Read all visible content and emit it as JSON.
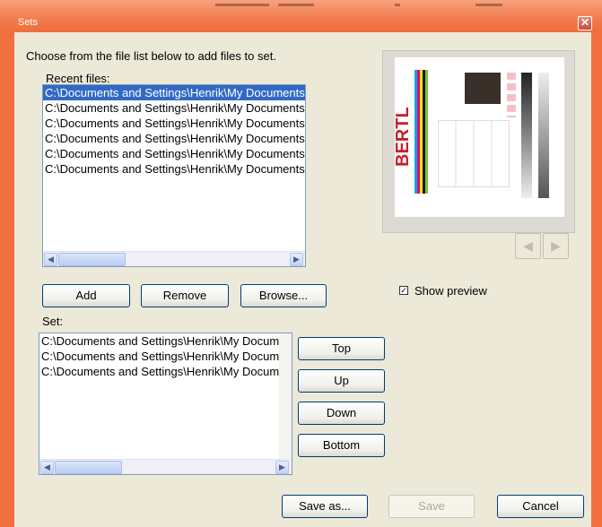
{
  "window": {
    "title": "Sets",
    "close_icon": "close-icon"
  },
  "instruction": "Choose from the file list below to add files to set.",
  "recent": {
    "label": "Recent files:",
    "items": [
      "C:\\Documents and Settings\\Henrik\\My Documents",
      "C:\\Documents and Settings\\Henrik\\My Documents",
      "C:\\Documents and Settings\\Henrik\\My Documents",
      "C:\\Documents and Settings\\Henrik\\My Documents",
      "C:\\Documents and Settings\\Henrik\\My Documents",
      "C:\\Documents and Settings\\Henrik\\My Documents"
    ],
    "selected_index": 0
  },
  "buttons": {
    "add": "Add",
    "remove": "Remove",
    "browse": "Browse...",
    "top": "Top",
    "up": "Up",
    "down": "Down",
    "bottom": "Bottom",
    "save_as": "Save as...",
    "save": "Save",
    "cancel": "Cancel"
  },
  "set": {
    "label": "Set:",
    "items": [
      "C:\\Documents and Settings\\Henrik\\My Documents",
      "C:\\Documents and Settings\\Henrik\\My Documents",
      "C:\\Documents and Settings\\Henrik\\My Documents"
    ]
  },
  "preview": {
    "show_preview_label": "Show preview",
    "show_preview_checked": true,
    "check_mark": "✓",
    "doc_logo": "BERTL",
    "prev_icon": "chevron-left-icon",
    "next_icon": "chevron-right-icon",
    "prev_glyph": "◀",
    "next_glyph": "▶"
  },
  "scroll_glyphs": {
    "left": "◀",
    "right": "▶"
  },
  "colors": {
    "frame": "#f26f3f",
    "dialog_bg": "#ece9d8",
    "selection": "#316ac5",
    "logo_red": "#c8202c"
  }
}
